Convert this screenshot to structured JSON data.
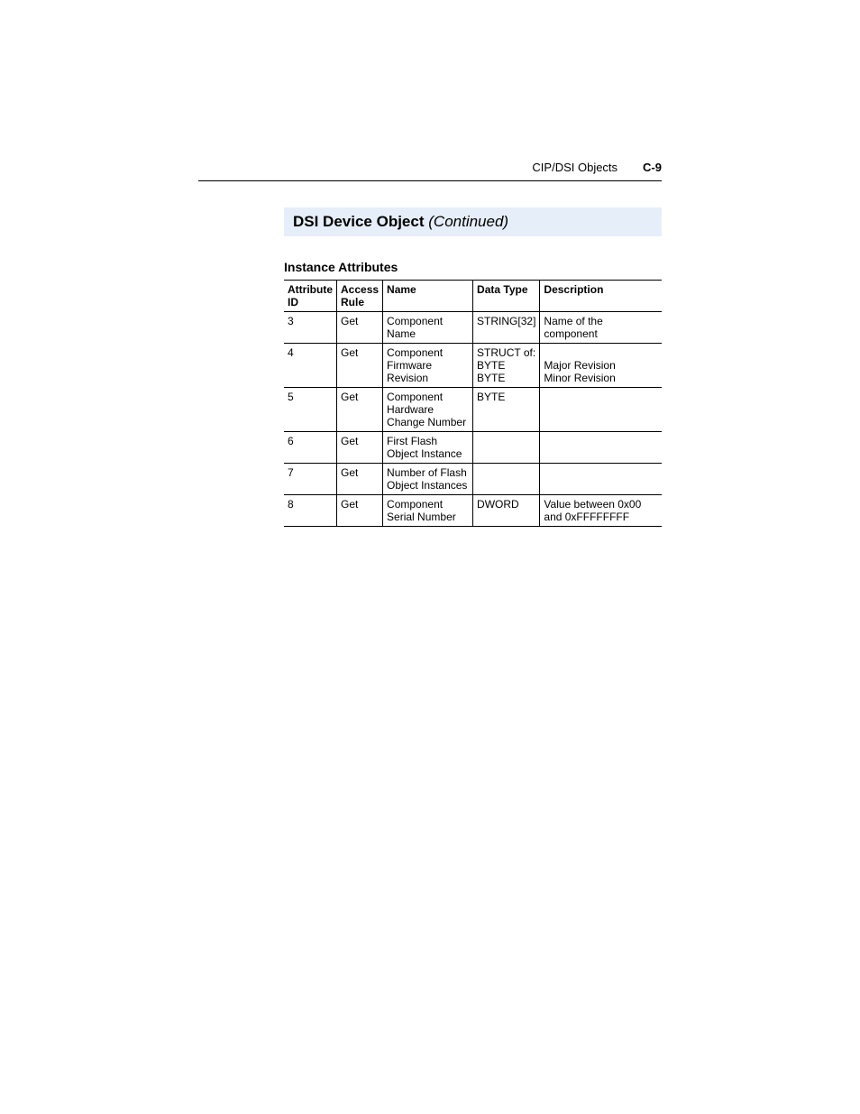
{
  "header": {
    "running_title": "CIP/DSI Objects",
    "page_number": "C-9"
  },
  "section": {
    "title": "DSI Device Object",
    "continued": "(Continued)"
  },
  "table": {
    "caption": "Instance Attributes",
    "columns": {
      "attr_id": "Attribute ID",
      "access": "Access Rule",
      "name": "Name",
      "dtype": "Data Type",
      "desc": "Description"
    },
    "rows": [
      {
        "attr_id": "3",
        "access": "Get",
        "name": "Component Name",
        "dtype": "STRING[32]",
        "desc": "Name of the component"
      },
      {
        "attr_id": "4",
        "access": "Get",
        "name": "Component Firmware Revision",
        "dtype": "STRUCT of:\n    BYTE\n    BYTE",
        "desc": "\nMajor Revision\nMinor Revision"
      },
      {
        "attr_id": "5",
        "access": "Get",
        "name": "Component Hardware Change Number",
        "dtype": "BYTE",
        "desc": ""
      },
      {
        "attr_id": "6",
        "access": "Get",
        "name": "First Flash Object Instance",
        "dtype": "",
        "desc": ""
      },
      {
        "attr_id": "7",
        "access": "Get",
        "name": "Number of Flash Object Instances",
        "dtype": "",
        "desc": ""
      },
      {
        "attr_id": "8",
        "access": "Get",
        "name": "Component Serial Number",
        "dtype": "DWORD",
        "desc": "Value between 0x00 and 0xFFFFFFFF"
      }
    ]
  }
}
